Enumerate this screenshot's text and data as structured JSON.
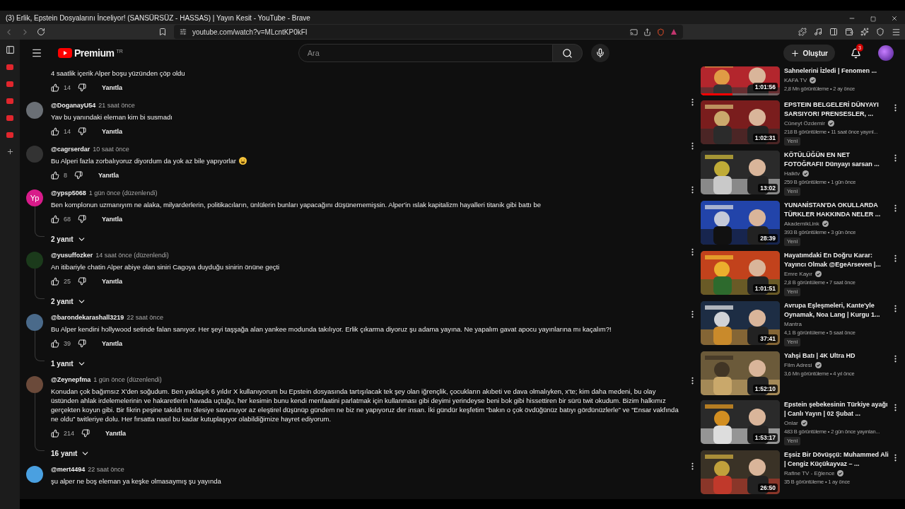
{
  "window": {
    "title": "(3) Erlik, Epstein Dosyalarını İnceliyor! (SANSÜRSÜZ - HASSAS) | Yayın Kesit - YouTube - Brave"
  },
  "browser": {
    "url": "youtube.com/watch?v=MLcntKP0kFI"
  },
  "header": {
    "logo": "Premium",
    "region": "TR",
    "search": {
      "placeholder": "Ara"
    },
    "create": "Oluştur",
    "notifications": "3"
  },
  "comments": [
    {
      "text": "4 saatlik içerik Alper boşu yüzünden çöp oldu",
      "likes": "14",
      "reply": "Yanıtla",
      "emoji": false
    },
    {
      "author": "@DoganayU54",
      "time": "21 saat önce",
      "text": "Yav bu yanındaki eleman kim bi susmadı",
      "likes": "14",
      "reply": "Yanıtla",
      "emoji": false
    },
    {
      "author": "@cagrserdar",
      "time": "10 saat önce",
      "text": "Bu Alperi fazla zorbalıyoruz diyordum da yok az bile yapıyorlar",
      "likes": "8",
      "reply": "Yanıtla",
      "emoji": true
    },
    {
      "author": "@ypsp5068",
      "time": "1 gün önce (düzenlendi)",
      "initials": "Yp",
      "text": "Ben komplonun uzmanıyım ne alaka, milyarderlerin, politikacıların, ünlülerin bunları yapacağını düşünememişsin. Alper'in ıslak kapitalizm hayalleri titanik gibi battı be",
      "likes": "68",
      "reply": "Yanıtla",
      "replies": "2 yanıt",
      "emoji": false
    },
    {
      "author": "@yusuffozker",
      "time": "14 saat önce (düzenlendi)",
      "text": "An itibariyle chatin Alper abiye olan siniri Cagoya duyduğu sinirin önüne geçti",
      "likes": "25",
      "reply": "Yanıtla",
      "replies": "2 yanıt",
      "emoji": false
    },
    {
      "author": "@barondekarashall3219",
      "time": "22 saat önce",
      "text": "Bu Alper kendini hollywood setinde falan sanıyor. Her şeyi taşşağa alan yankee modunda takılıyor. Erlik çıkarma diyoruz şu adama yayına. Ne yapalım gavat apocu yayınlarına mı kaçalım?!",
      "likes": "39",
      "reply": "Yanıtla",
      "replies": "1 yanıt",
      "emoji": false
    },
    {
      "author": "@Zeynepfma",
      "time": "1 gün önce (düzenlendi)",
      "text": "Konudan çok bağımsız X'den soğudum. Ben yaklaşık 6 yıldır X kullanıyorum bu Epstein dosyasında tartışılacak tek şey olan iğrençlik, çocukların akıbeti ve dava olmalıyken, x'te; kim daha medeni, bu olay üstünden ahlak irdelemelerinin ve hakaretlerin havada uçtuğu, her kesimin bunu kendi menfaatini parlatmak için kullanması gibi deyimi yerindeyse beni bok gibi hissettiren bir sürü twit okudum. Bizim halkımız gerçekten koyun gibi. Bir fikrin peşine takıldı mı ölesiye savunuyor az eleştirel düşünüp gündem ne biz ne yapıyoruz der insan. İki gündür keşfetim “bakın o çok övdüğünüz batıyı gördünüzlerle” ve “Ensar vakfında ne oldu” twitleriye dolu. Her fırsatta nasıl bu kadar kutuplaşıyor olabildiğimize hayret ediyorum.",
      "likes": "214",
      "reply": "Yanıtla",
      "replies": "16 yanıt",
      "emoji": false
    },
    {
      "author": "@mert4494",
      "time": "22 saat önce",
      "text": "şu alper ne boş eleman ya keşke olmasaymış şu yayında",
      "emoji": false
    }
  ],
  "related": [
    {
      "title": "Sahnelerini İzledi | Fenomen ...",
      "channel": "KAFA TV",
      "verified": true,
      "meta": "2,8 Mn görüntüleme • 2 ay önce",
      "duration": "1:01:56",
      "cut": true,
      "level": 0.4
    },
    {
      "title": "EPSTEIN BELGELERİ DÜNYAYI SARSIYOR! PRENSESLER, ...",
      "channel": "Cüneyt Özdemir",
      "verified": true,
      "meta": "218 B görüntüleme • 11 saat önce yayınl...",
      "duration": "1:02:31",
      "badge": "Yeni"
    },
    {
      "title": "KÖTÜLÜĞÜN EN NET FOTOĞRAFI! Dünyayı sarsan ...",
      "channel": "Halktv",
      "verified": true,
      "meta": "259 B görüntüleme • 1 gün önce",
      "duration": "13:02",
      "badge": "Yeni"
    },
    {
      "title": "YUNANİSTAN'DA OKULLARDA TÜRKLER HAKKINDA NELER ...",
      "channel": "AkademikLink",
      "verified": true,
      "meta": "393 B görüntüleme • 3 gün önce",
      "duration": "28:39",
      "badge": "Yeni"
    },
    {
      "title": "Hayatımdaki En Doğru Karar: Yayıncı Olmak @EgeArseven  |...",
      "channel": "Emre Kayır",
      "verified": true,
      "meta": "2,8 B görüntüleme • 7 saat önce",
      "duration": "1:01:51",
      "badge": "Yeni"
    },
    {
      "title": "Avrupa Eşleşmeleri, Kante'yle Oynamak, Noa Lang | Kurgu 1...",
      "channel": "Mantra",
      "verified": false,
      "meta": "4,1 B görüntüleme • 5 saat önce",
      "duration": "37:41",
      "badge": "Yeni"
    },
    {
      "title": "Yahşi Batı | 4K Ultra HD",
      "channel": "Film Adresi",
      "verified": true,
      "meta": "3,6 Mn görüntüleme • 4 yıl önce",
      "duration": "1:52:10"
    },
    {
      "title": "Epstein şebekesinin Türkiye ayağı | Canlı Yayın | 02 Şubat ...",
      "channel": "Onlar",
      "verified": true,
      "meta": "483 B görüntüleme • 2 gün önce yayınlan...",
      "duration": "1:53:17",
      "badge": "Yeni"
    },
    {
      "title": "Eşsiz Bir Dövüşçü: Muhammed Ali | Cengiz Küçükayvaz – ...",
      "channel": "Rafine TV - Eğlence",
      "verified": true,
      "meta": "35 B görüntüleme • 1 ay önce",
      "duration": "26:50"
    }
  ]
}
